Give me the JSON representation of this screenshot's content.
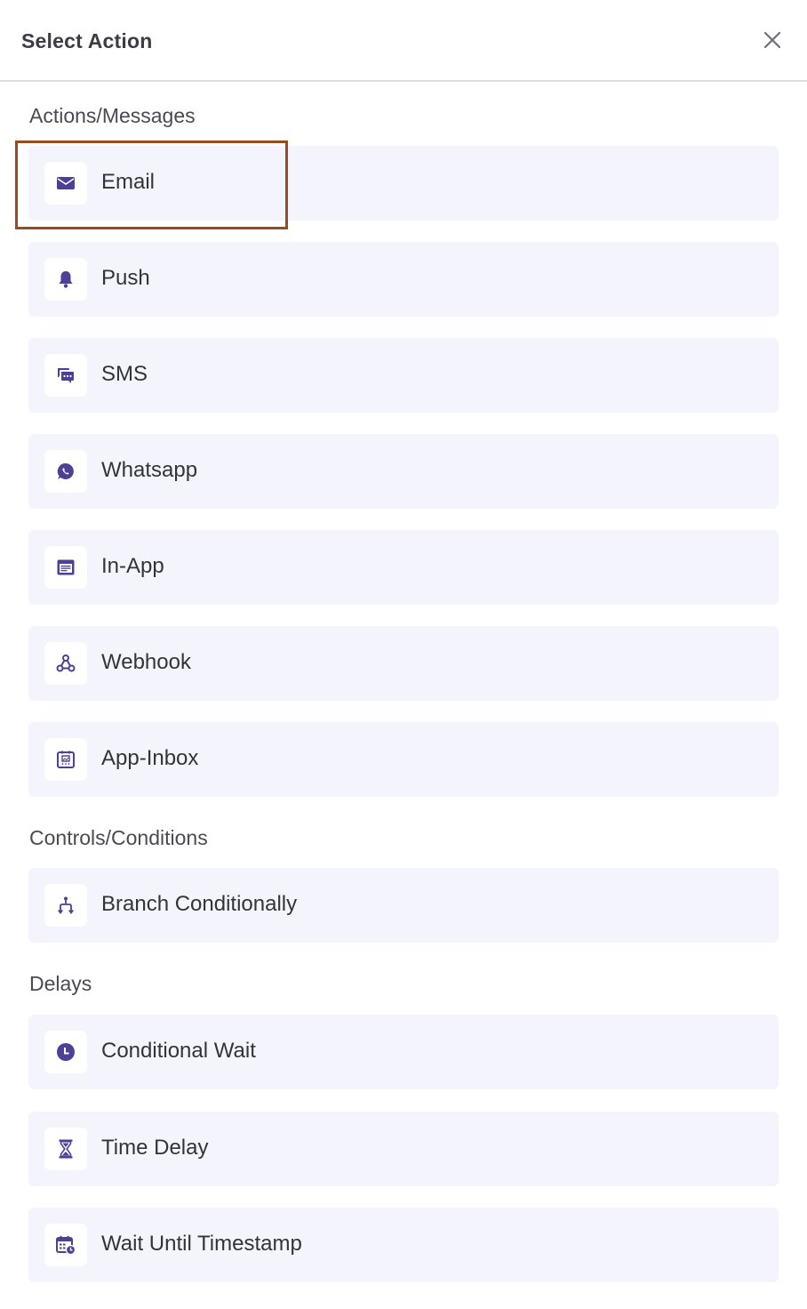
{
  "header": {
    "title": "Select Action",
    "close_icon": "close-icon"
  },
  "sections": {
    "actions": {
      "label": "Actions/Messages",
      "items": [
        {
          "label": "Email",
          "icon": "envelope-icon"
        },
        {
          "label": "Push",
          "icon": "bell-icon"
        },
        {
          "label": "SMS",
          "icon": "chat-bubbles-icon"
        },
        {
          "label": "Whatsapp",
          "icon": "whatsapp-icon"
        },
        {
          "label": "In-App",
          "icon": "in-app-window-icon"
        },
        {
          "label": "Webhook",
          "icon": "webhook-icon"
        },
        {
          "label": "App-Inbox",
          "icon": "app-inbox-icon"
        }
      ]
    },
    "controls": {
      "label": "Controls/Conditions",
      "items": [
        {
          "label": "Branch Conditionally",
          "icon": "branch-icon"
        }
      ]
    },
    "delays": {
      "label": "Delays",
      "items": [
        {
          "label": "Conditional Wait",
          "icon": "clock-icon"
        },
        {
          "label": "Time Delay",
          "icon": "hourglass-icon"
        },
        {
          "label": "Wait Until Timestamp",
          "icon": "calendar-clock-icon"
        }
      ]
    }
  },
  "colors": {
    "accent": "#4e3f97",
    "item_background": "#f4f4fd",
    "highlight_border": "#9a4a1c"
  }
}
